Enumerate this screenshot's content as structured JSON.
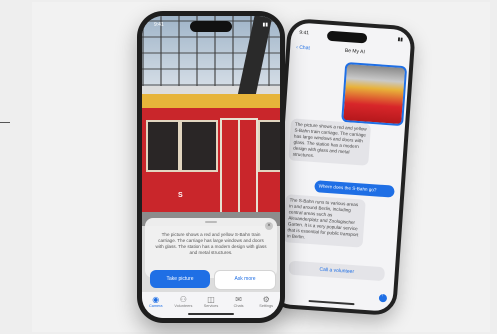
{
  "front": {
    "time": "9:41",
    "logo_text": "S",
    "close_label": "×",
    "description": "The picture shows a red and yellow S-Bahn train carriage. The carriage has large windows and doors with glass. The station has a modern design with glass and metal structures.",
    "take_picture": "Take picture",
    "ask_more": "Ask more",
    "tabs": [
      {
        "icon": "◉",
        "label": "Camera"
      },
      {
        "icon": "⚇",
        "label": "Volunteers"
      },
      {
        "icon": "◫",
        "label": "Services"
      },
      {
        "icon": "✉",
        "label": "Chats"
      },
      {
        "icon": "⚙",
        "label": "Settings"
      }
    ]
  },
  "back": {
    "time": "9:41",
    "back_label": "‹ Chat",
    "title": "Be My AI",
    "bubbles": [
      {
        "text": "The picture shows a red and yellow S-Bahn train carriage. The carriage has large windows and doors with glass. The station has a modern design with glass and metal structures."
      },
      {
        "text": "Where does the S-Bahn go?"
      },
      {
        "text": "The S-Bahn runs to various areas in and around Berlin, including central areas such as Alexanderplatz and Zoologischer Garten. It is a very popular service that is essential for public transport in Berlin."
      }
    ],
    "call_volunteer": "Call a volunteer",
    "send_icon": "send-icon"
  },
  "colors": {
    "accent": "#1f6fe5",
    "train_red": "#c9262b",
    "train_yellow": "#e7b43a"
  }
}
